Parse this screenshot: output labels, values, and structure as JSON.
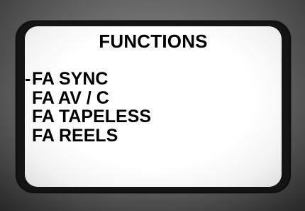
{
  "screen": {
    "title": "FUNCTIONS",
    "cursor": "-",
    "items": [
      {
        "label": "FA SYNC",
        "selected": true
      },
      {
        "label": "FA AV / C",
        "selected": false
      },
      {
        "label": "FA TAPELESS",
        "selected": false
      },
      {
        "label": "FA REELS",
        "selected": false
      }
    ]
  },
  "colors": {
    "screen_bg": "#ffffff",
    "text": "#000000",
    "frame": "#141414",
    "bezel": "#7a7a7a"
  }
}
